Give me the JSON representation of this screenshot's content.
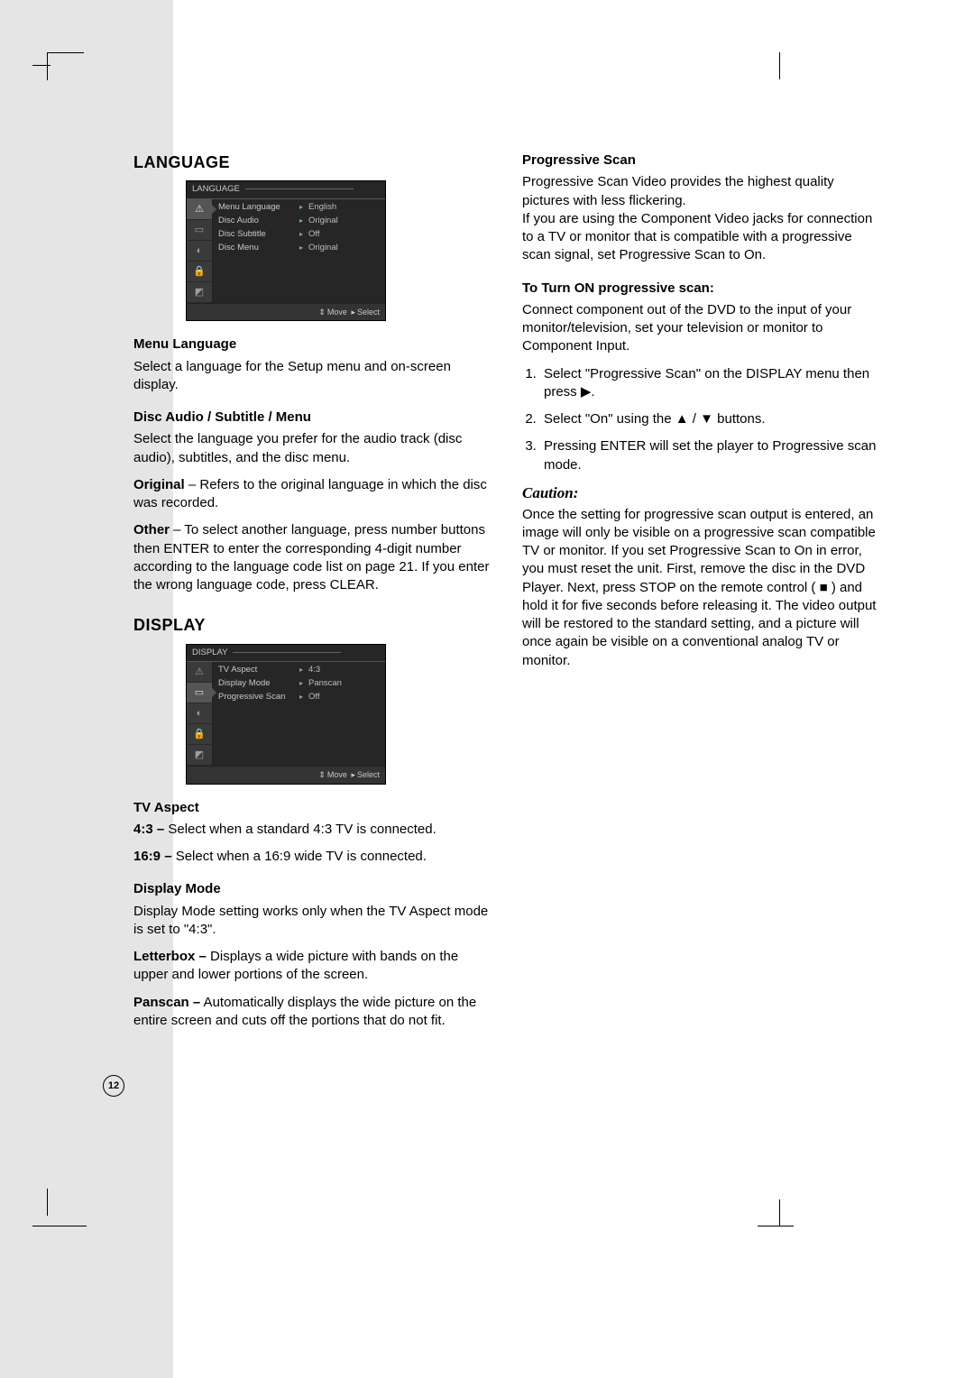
{
  "page_number": "12",
  "left": {
    "language_heading": "LANGUAGE",
    "lang_screenshot": {
      "title": "LANGUAGE",
      "rows": [
        {
          "k": "Menu Language",
          "v": "English"
        },
        {
          "k": "Disc Audio",
          "v": "Original"
        },
        {
          "k": "Disc Subtitle",
          "v": "Off"
        },
        {
          "k": "Disc Menu",
          "v": "Original"
        }
      ],
      "footer_move": "Move",
      "footer_select": "Select",
      "nav_icons": [
        "warning-triangle-icon",
        "monitor-icon",
        "speaker-icon",
        "lock-icon",
        "tag-icon"
      ],
      "selected_nav": 0
    },
    "menu_lang_h": "Menu Language",
    "menu_lang_p": "Select a language for the Setup menu and on-screen display.",
    "dasm_h": "Disc Audio / Subtitle / Menu",
    "dasm_p": "Select the language you prefer for the audio track (disc audio), subtitles, and the disc menu.",
    "original_b": "Original",
    "original_t": " – Refers to the original language in which the disc was recorded.",
    "other_b": "Other",
    "other_t": " – To select another language, press number buttons then ENTER to enter the corresponding 4-digit number according to the language code list on page 21. If you enter the wrong language code, press CLEAR.",
    "display_heading": "DISPLAY",
    "disp_screenshot": {
      "title": "DISPLAY",
      "rows": [
        {
          "k": "TV Aspect",
          "v": "4:3"
        },
        {
          "k": "Display Mode",
          "v": "Panscan"
        },
        {
          "k": "Progressive Scan",
          "v": "Off"
        }
      ],
      "footer_move": "Move",
      "footer_select": "Select",
      "nav_icons": [
        "warning-triangle-icon",
        "monitor-icon",
        "speaker-icon",
        "lock-icon",
        "tag-icon"
      ],
      "selected_nav": 1
    },
    "tvaspect_h": "TV Aspect",
    "tv43_b": "4:3 –",
    "tv43_t": " Select when a standard 4:3 TV is connected.",
    "tv169_b": "16:9 –",
    "tv169_t": " Select when a 16:9 wide TV is connected.",
    "dmode_h": "Display Mode",
    "dmode_p": "Display Mode setting works only when the TV Aspect mode is set to \"4:3\".",
    "letter_b": "Letterbox –",
    "letter_t": " Displays a wide picture with bands on the upper and lower portions of the screen.",
    "pan_b": "Panscan –",
    "pan_t": " Automatically displays the wide picture on the entire screen and cuts off the portions that do not fit."
  },
  "right": {
    "ps_h": "Progressive Scan",
    "ps_p1": "Progressive Scan Video provides the highest quality pictures with less flickering.",
    "ps_p2": "If you are using the Component Video jacks for connection to a TV or monitor that is compatible with a progressive scan signal, set Progressive Scan to On.",
    "turnon_h": "To Turn ON progressive scan:",
    "turnon_p": "Connect component out of the DVD to the input of your monitor/television, set your television or monitor to Component Input.",
    "step1a": "Select \"Progressive Scan\" on the DISPLAY menu then press ",
    "step1b": ".",
    "step2a": "Select \"On\" using the ",
    "step2b": " / ",
    "step2c": " buttons.",
    "step3": "Pressing ENTER will set the player to Progressive scan mode.",
    "caution_h": "Caution:",
    "caution_p1": "Once the setting for progressive scan output is entered, an image will only be visible on a progressive scan compatible TV or monitor. If you set Progressive Scan to On in error, you must reset the unit. First, remove the disc in the DVD Player. Next, press STOP on the remote control ( ",
    "caution_p2": " ) and hold it for five seconds before releasing it. The video output will be restored to the standard setting, and a picture will once again be visible on a conventional analog TV or monitor."
  }
}
